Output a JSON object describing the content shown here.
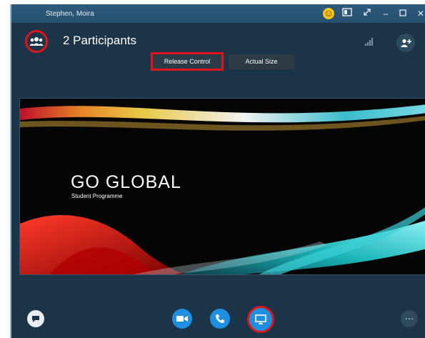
{
  "window": {
    "title": "Stephen, Moira",
    "titlebar_icons": [
      "emoji-icon",
      "layout-icon",
      "expand-icon",
      "minimize-icon",
      "maximize-icon",
      "close-icon"
    ]
  },
  "call": {
    "participants_label": "2 Participants",
    "participants_icon": "participants-icon",
    "signal_icon": "signal-strength-icon",
    "add_person_icon": "add-person-icon"
  },
  "toolbar": {
    "release_control": "Release Control",
    "actual_size": "Actual Size"
  },
  "slide": {
    "title": "GO GLOBAL",
    "subtitle": "Student Programme"
  },
  "controls": {
    "chat_icon": "chat-icon",
    "video_icon": "video-camera-icon",
    "audio_icon": "phone-icon",
    "share_icon": "screen-share-icon",
    "more_label": "···"
  },
  "colors": {
    "background": "#1b3447",
    "titlebar": "#2a5677",
    "accent_blue": "#1f8fe0",
    "highlight_red": "#e2141b"
  }
}
